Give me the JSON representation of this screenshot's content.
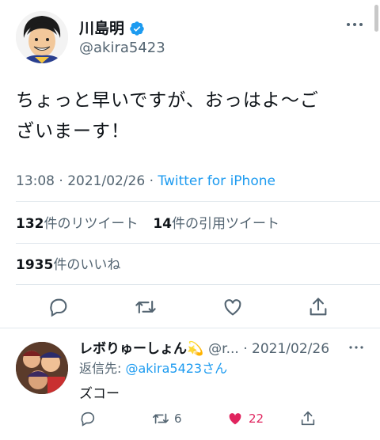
{
  "tweet": {
    "author_name": "川島明",
    "handle": "@akira5423",
    "text_line1": "ちょっと早いですが、おっはよ～ご",
    "text_line2": "ざいまーす！",
    "time": "13:08 · 2021/02/26 · ",
    "source": "Twitter for iPhone",
    "retweets_count": "132",
    "retweets_label": "件のリツイート",
    "quotes_count": "14",
    "quotes_label": "件の引用ツイート",
    "likes_count": "1935",
    "likes_label": "件のいいね"
  },
  "reply": {
    "author_name": "レボりゅーしょん💫",
    "meta": "@r... · 2021/02/26",
    "reply_to_prefix": "返信先: ",
    "reply_to_handle": "@akira5423さん",
    "text": "ズコー",
    "retweet_count": "6",
    "like_count": "22"
  },
  "colors": {
    "accent": "#1d9bf0",
    "like": "#e0245e",
    "secondary_text": "#536471"
  }
}
